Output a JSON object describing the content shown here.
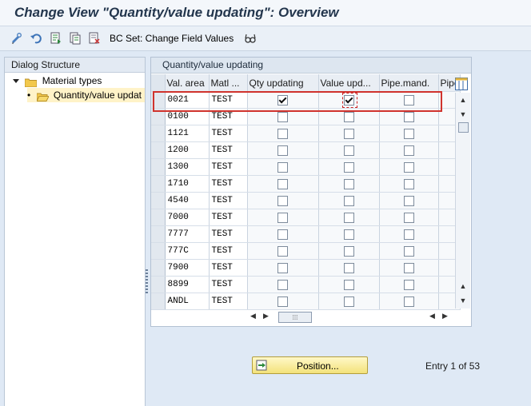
{
  "window": {
    "title": "Change View \"Quantity/value updating\": Overview"
  },
  "toolbar": {
    "bc_set_label": "BC Set: Change Field Values",
    "icons": [
      "edit-display-icon",
      "undo-icon",
      "new-entries-icon",
      "copy-icon",
      "delete-icon",
      "glasses-icon"
    ]
  },
  "dialog_structure": {
    "header": "Dialog Structure",
    "items": [
      {
        "label": "Material types"
      },
      {
        "label": "Quantity/value updat"
      }
    ]
  },
  "table": {
    "title": "Quantity/value updating",
    "columns": [
      "Val. area",
      "Matl ...",
      "Qty updating",
      "Value upd...",
      "Pipe.mand.",
      "Pipe"
    ],
    "rows": [
      {
        "val_area": "0021",
        "matl": "TEST",
        "qty": true,
        "value": true,
        "pipe": false
      },
      {
        "val_area": "0100",
        "matl": "TEST",
        "qty": false,
        "value": false,
        "pipe": false
      },
      {
        "val_area": "1121",
        "matl": "TEST",
        "qty": false,
        "value": false,
        "pipe": false
      },
      {
        "val_area": "1200",
        "matl": "TEST",
        "qty": false,
        "value": false,
        "pipe": false
      },
      {
        "val_area": "1300",
        "matl": "TEST",
        "qty": false,
        "value": false,
        "pipe": false
      },
      {
        "val_area": "1710",
        "matl": "TEST",
        "qty": false,
        "value": false,
        "pipe": false
      },
      {
        "val_area": "4540",
        "matl": "TEST",
        "qty": false,
        "value": false,
        "pipe": false
      },
      {
        "val_area": "7000",
        "matl": "TEST",
        "qty": false,
        "value": false,
        "pipe": false
      },
      {
        "val_area": "7777",
        "matl": "TEST",
        "qty": false,
        "value": false,
        "pipe": false
      },
      {
        "val_area": "777C",
        "matl": "TEST",
        "qty": false,
        "value": false,
        "pipe": false
      },
      {
        "val_area": "7900",
        "matl": "TEST",
        "qty": false,
        "value": false,
        "pipe": false
      },
      {
        "val_area": "8899",
        "matl": "TEST",
        "qty": false,
        "value": false,
        "pipe": false
      },
      {
        "val_area": "ANDL",
        "matl": "TEST",
        "qty": false,
        "value": false,
        "pipe": false
      }
    ]
  },
  "footer": {
    "position_label": "Position...",
    "entry_text": "Entry 1 of 53"
  },
  "colors": {
    "highlight": "#d0332d",
    "background": "#dfe9f5",
    "position_button": "#f3e27a"
  }
}
